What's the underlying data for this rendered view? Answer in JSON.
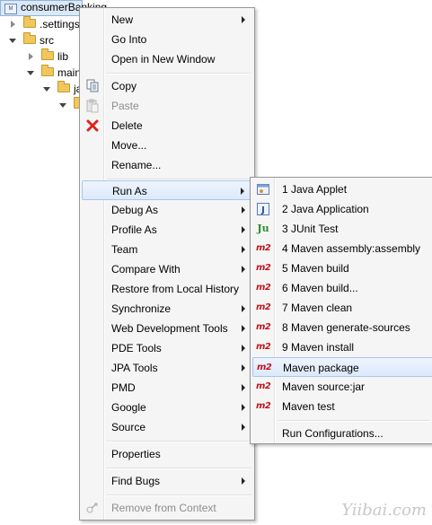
{
  "tree": {
    "project": "consumerBanking",
    "items": [
      {
        "label": ".settings",
        "expanded": false
      },
      {
        "label": "src",
        "expanded": true
      },
      {
        "label": "lib",
        "expanded": false
      },
      {
        "label": "main",
        "expanded": true
      },
      {
        "label": "ja",
        "expanded": true
      },
      {
        "label": "",
        "expanded": true
      }
    ]
  },
  "menu": {
    "items": [
      {
        "label": "New",
        "submenu": true,
        "icon": ""
      },
      {
        "label": "Go Into",
        "submenu": false,
        "icon": ""
      },
      {
        "label": "Open in New Window",
        "submenu": false,
        "icon": ""
      },
      {
        "label": "Copy",
        "submenu": false,
        "icon": "copy-icon"
      },
      {
        "label": "Paste",
        "submenu": false,
        "icon": "paste-icon",
        "disabled": true
      },
      {
        "label": "Delete",
        "submenu": false,
        "icon": "delete-icon"
      },
      {
        "label": "Move...",
        "submenu": false,
        "icon": ""
      },
      {
        "label": "Rename...",
        "submenu": false,
        "icon": ""
      },
      {
        "label": "Run As",
        "submenu": true,
        "icon": "",
        "highlighted": true
      },
      {
        "label": "Debug As",
        "submenu": true,
        "icon": ""
      },
      {
        "label": "Profile As",
        "submenu": true,
        "icon": ""
      },
      {
        "label": "Team",
        "submenu": true,
        "icon": ""
      },
      {
        "label": "Compare With",
        "submenu": true,
        "icon": ""
      },
      {
        "label": "Restore from Local History",
        "submenu": false,
        "icon": ""
      },
      {
        "label": "Synchronize",
        "submenu": true,
        "icon": ""
      },
      {
        "label": "Web Development Tools",
        "submenu": true,
        "icon": ""
      },
      {
        "label": "PDE Tools",
        "submenu": true,
        "icon": ""
      },
      {
        "label": "JPA Tools",
        "submenu": true,
        "icon": ""
      },
      {
        "label": "PMD",
        "submenu": true,
        "icon": ""
      },
      {
        "label": "Google",
        "submenu": true,
        "icon": ""
      },
      {
        "label": "Source",
        "submenu": true,
        "icon": ""
      },
      {
        "label": "Properties",
        "submenu": false,
        "icon": ""
      },
      {
        "label": "Find Bugs",
        "submenu": true,
        "icon": ""
      },
      {
        "label": "Remove from Context",
        "submenu": false,
        "icon": "context-icon",
        "disabled": true
      }
    ]
  },
  "submenu": {
    "items": [
      {
        "label": "1 Java Applet",
        "icon": "java-applet-icon"
      },
      {
        "label": "2 Java Application",
        "icon": "java-application-icon"
      },
      {
        "label": "3 JUnit Test",
        "icon": "junit-icon",
        "icon_text": "Ju"
      },
      {
        "label": "4 Maven assembly:assembly",
        "icon": "maven-icon",
        "icon_text": "m2"
      },
      {
        "label": "5 Maven build",
        "icon": "maven-icon",
        "icon_text": "m2"
      },
      {
        "label": "6 Maven build...",
        "icon": "maven-icon",
        "icon_text": "m2"
      },
      {
        "label": "7 Maven clean",
        "icon": "maven-icon",
        "icon_text": "m2"
      },
      {
        "label": "8 Maven generate-sources",
        "icon": "maven-icon",
        "icon_text": "m2"
      },
      {
        "label": "9 Maven install",
        "icon": "maven-icon",
        "icon_text": "m2"
      },
      {
        "label": "Maven package",
        "icon": "maven-icon",
        "icon_text": "m2",
        "highlighted": true
      },
      {
        "label": "Maven source:jar",
        "icon": "maven-icon",
        "icon_text": "m2"
      },
      {
        "label": "Maven test",
        "icon": "maven-icon",
        "icon_text": "m2"
      },
      {
        "label": "Run Configurations...",
        "icon": ""
      }
    ]
  },
  "watermark": "Yiibai.com",
  "colors": {
    "highlight": "#dce9fb",
    "menu_bg": "#f5f5f5",
    "maven_red": "#c0161e",
    "delete_red": "#d9261c"
  }
}
